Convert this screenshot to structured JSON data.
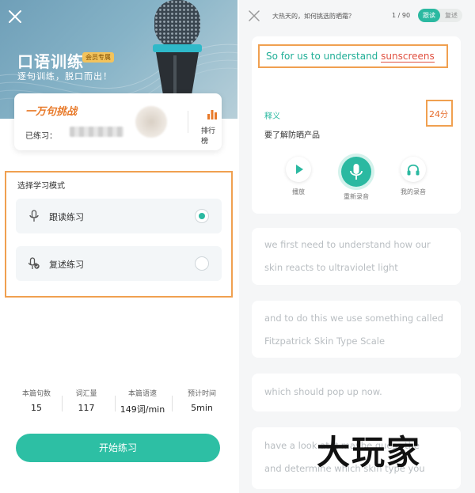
{
  "left": {
    "hero": {
      "title": "口语训练",
      "vip_tag": "会员专属",
      "subtitle": "逐句训练，脱口而出！"
    },
    "challenge": {
      "title": "一万句挑战",
      "practiced_label": "已练习：",
      "rank_label": "排行榜"
    },
    "mode": {
      "heading": "选择学习模式",
      "options": [
        {
          "label": "跟读练习",
          "selected": true
        },
        {
          "label": "复述练习",
          "selected": false
        }
      ]
    },
    "stats": [
      {
        "label": "本篇句数",
        "value": "15"
      },
      {
        "label": "词汇量",
        "value": "117"
      },
      {
        "label": "本篇语速",
        "value": "149词/min"
      },
      {
        "label": "预计时间",
        "value": "5min"
      }
    ],
    "start_button": "开始练习"
  },
  "right": {
    "header": {
      "title": "大热天的，如何挑选防晒霜？",
      "progress": "1 / 90",
      "mode_a": "跟读",
      "mode_b": "复述"
    },
    "current": {
      "sentence_prefix": "So for us to understand ",
      "sentence_highlight": "sunscreens",
      "meaning_label": "释义",
      "meaning": "要了解防晒产品",
      "score": "24",
      "score_unit": "分",
      "controls": [
        "播放",
        "重新录音",
        "我的录音"
      ]
    },
    "sentences": [
      {
        "line1": "we first need to understand how our",
        "line2": "skin reacts to ultraviolet light"
      },
      {
        "line1": "and to do this we use something called",
        "line2": "Fitzpatrick Skin Type Scale"
      },
      {
        "line1": "which should pop up now.",
        "line2": ""
      },
      {
        "line1": "have a look at it maybe guess the",
        "line2": "and determine which skin type you"
      }
    ]
  },
  "watermark": "大玩家",
  "colors": {
    "accent": "#2bb9a1",
    "highlight_box": "#f0a050",
    "score": "#e56b2a",
    "challenge": "#e87a2a"
  }
}
